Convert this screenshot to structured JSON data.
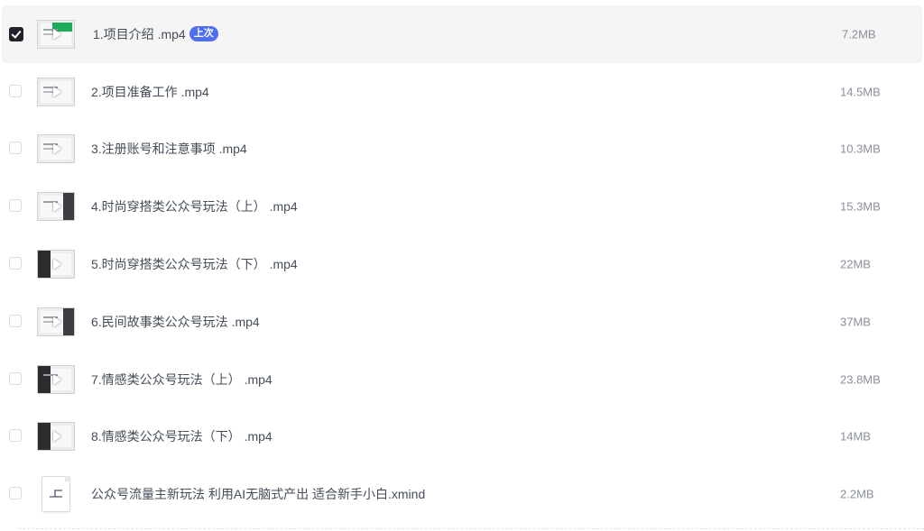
{
  "files": [
    {
      "name": "1.项目介绍 .mp4",
      "badge": "上次",
      "size": "7.2MB",
      "checked": true,
      "icon": "video-thumbnail"
    },
    {
      "name": "2.项目准备工作 .mp4",
      "size": "14.5MB",
      "checked": false,
      "icon": "video-thumbnail"
    },
    {
      "name": "3.注册账号和注意事项 .mp4",
      "size": "10.3MB",
      "checked": false,
      "icon": "video-thumbnail"
    },
    {
      "name": "4.时尚穿搭类公众号玩法（上） .mp4",
      "size": "15.3MB",
      "checked": false,
      "icon": "video-thumbnail"
    },
    {
      "name": "5.时尚穿搭类公众号玩法（下） .mp4",
      "size": "22MB",
      "checked": false,
      "icon": "video-thumbnail"
    },
    {
      "name": "6.民间故事类公众号玩法 .mp4",
      "size": "37MB",
      "checked": false,
      "icon": "video-thumbnail"
    },
    {
      "name": "7.情感类公众号玩法（上） .mp4",
      "size": "23.8MB",
      "checked": false,
      "icon": "video-thumbnail"
    },
    {
      "name": "8.情感类公众号玩法（下） .mp4",
      "size": "14MB",
      "checked": false,
      "icon": "video-thumbnail"
    },
    {
      "name": "公众号流量主新玩法 利用AI无脑式产出 适合新手小白.xmind",
      "size": "2.2MB",
      "checked": false,
      "icon": "mindmap-file-icon"
    }
  ],
  "colors": {
    "badge": "#4e6ef2",
    "selected_row": "#f5f5f6",
    "text": "#454d5a",
    "size_text": "#8a8f99"
  }
}
